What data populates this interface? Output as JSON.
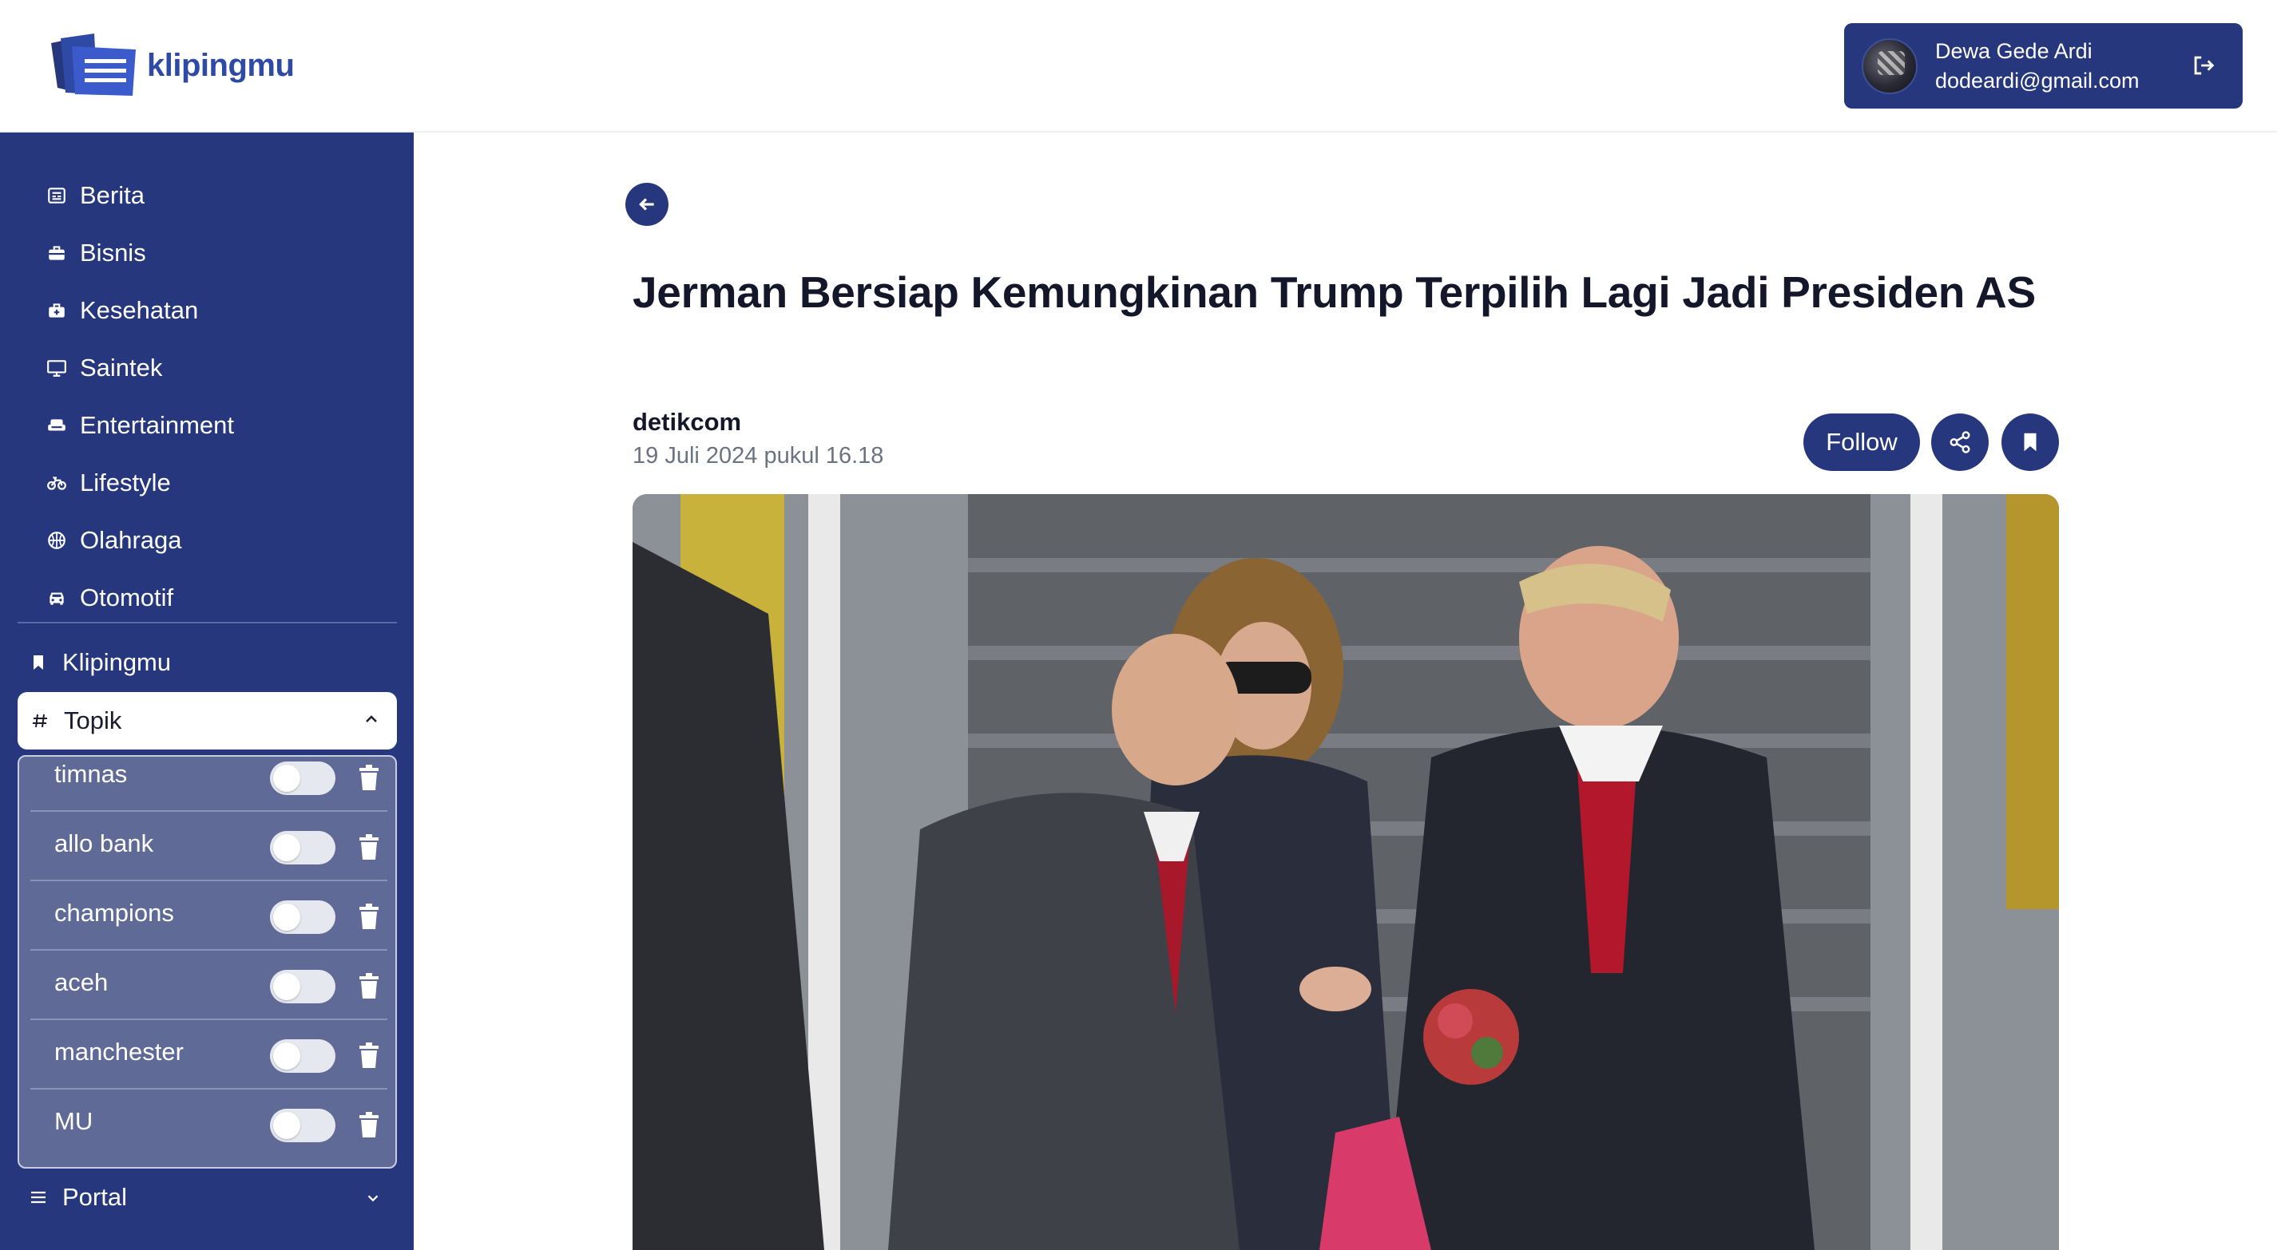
{
  "app": {
    "logo_text": "klipingmu",
    "brand_color": "#26377e",
    "accent_color": "#2f4aa5"
  },
  "user": {
    "name": "Dewa Gede Ardi",
    "email": "dodeardi@gmail.com",
    "logout_icon": "logout-icon"
  },
  "sidebar": {
    "categories": [
      {
        "label": "Berita",
        "icon": "newspaper-icon"
      },
      {
        "label": "Bisnis",
        "icon": "briefcase-icon"
      },
      {
        "label": "Kesehatan",
        "icon": "medkit-icon"
      },
      {
        "label": "Saintek",
        "icon": "monitor-icon"
      },
      {
        "label": "Entertainment",
        "icon": "couch-icon"
      },
      {
        "label": "Lifestyle",
        "icon": "bicycle-icon"
      },
      {
        "label": "Olahraga",
        "icon": "basketball-icon"
      },
      {
        "label": "Otomotif",
        "icon": "car-icon"
      }
    ],
    "klipingmu_label": "Klipingmu",
    "topik_label": "Topik",
    "topics": [
      {
        "label": "timnas",
        "enabled": false
      },
      {
        "label": "allo bank",
        "enabled": false
      },
      {
        "label": "champions",
        "enabled": false
      },
      {
        "label": "aceh",
        "enabled": false
      },
      {
        "label": "manchester",
        "enabled": false
      },
      {
        "label": "MU",
        "enabled": false
      }
    ],
    "portal_label": "Portal"
  },
  "article": {
    "title": "Jerman Bersiap Kemungkinan Trump Terpilih Lagi Jadi Presiden AS",
    "source": "detikcom",
    "date": "19 Juli 2024 pukul 16.18",
    "follow_label": "Follow",
    "share_icon": "share-icon",
    "bookmark_icon": "bookmark-icon"
  }
}
